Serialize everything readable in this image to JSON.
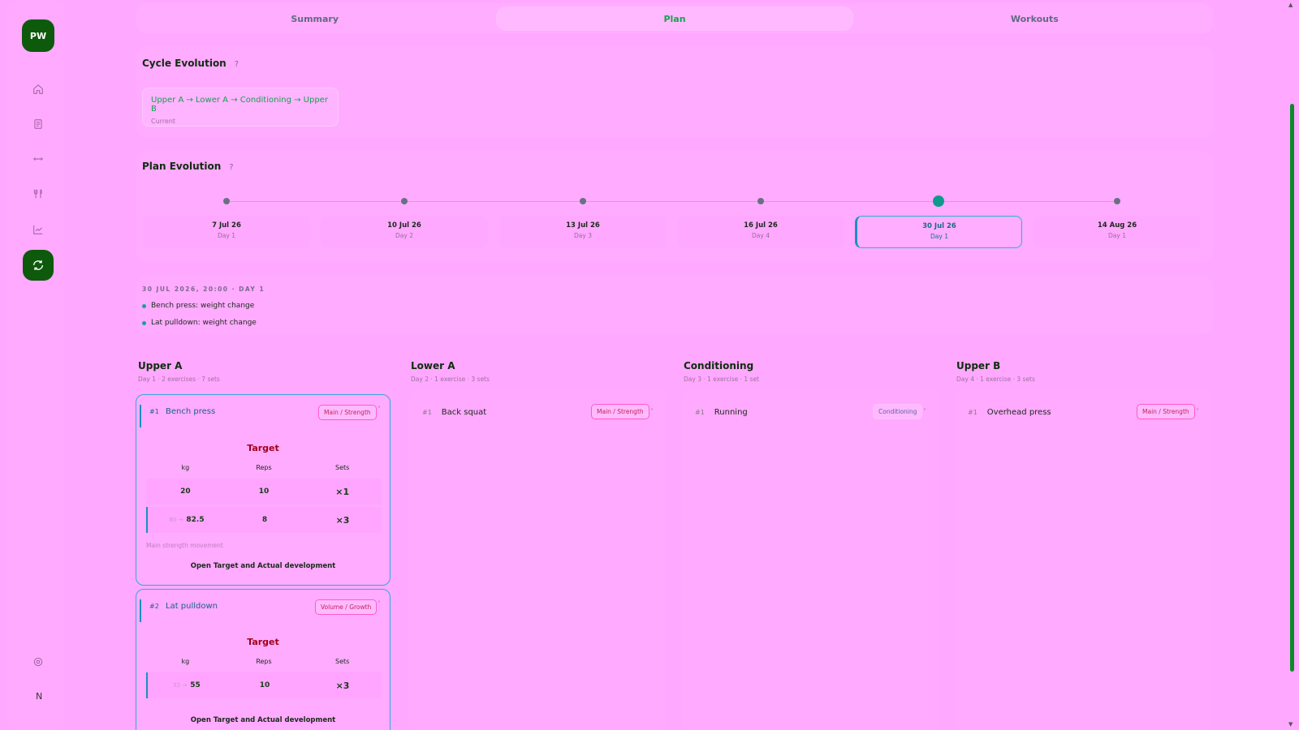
{
  "sidebar": {
    "logo": "PW",
    "user_initial": "N",
    "icons": [
      "home-icon",
      "document-icon",
      "dumbbell-icon",
      "utensils-icon",
      "chart-icon",
      "cycle-icon",
      "settings-icon"
    ]
  },
  "tabs": [
    {
      "label": "Summary"
    },
    {
      "label": "Plan",
      "active": true
    },
    {
      "label": "Workouts"
    }
  ],
  "cycle": {
    "title": "Cycle Evolution",
    "help": "?",
    "sequence": "Upper A → Lower A → Conditioning → Upper B",
    "status": "Current"
  },
  "plan": {
    "title": "Plan Evolution",
    "help": "?",
    "timeline": [
      {
        "date": "7 Jul 26",
        "day": "Day 1"
      },
      {
        "date": "10 Jul 26",
        "day": "Day 2"
      },
      {
        "date": "13 Jul 26",
        "day": "Day 3"
      },
      {
        "date": "16 Jul 26",
        "day": "Day 4"
      },
      {
        "date": "30 Jul 26",
        "day": "Day 1",
        "selected": true
      },
      {
        "date": "14 Aug 26",
        "day": "Day 1"
      }
    ],
    "changes_header": "30 JUL 2026, 20:00 · DAY 1",
    "changes": [
      "Bench press: weight change",
      "Lat pulldown: weight change"
    ]
  },
  "days": [
    {
      "title": "Upper A",
      "subtitle": "Day 1 · 2 exercises · 7 sets",
      "exercises": [
        {
          "num": "#1",
          "name": "Bench press",
          "badge": "Main / Strength",
          "target_label": "Target",
          "columns": [
            "kg",
            "Reps",
            "Sets"
          ],
          "rows": [
            {
              "prev": "",
              "kg": "20",
              "reps": "10",
              "sets": "×1"
            },
            {
              "prev": "80 →",
              "kg": "82.5",
              "reps": "8",
              "sets": "×3"
            }
          ],
          "note": "Main strength movement",
          "link": "Open Target and Actual development"
        },
        {
          "num": "#2",
          "name": "Lat pulldown",
          "badge": "Volume / Growth",
          "target_label": "Target",
          "columns": [
            "kg",
            "Reps",
            "Sets"
          ],
          "rows": [
            {
              "prev": "52 →",
              "kg": "55",
              "reps": "10",
              "sets": "×3"
            }
          ],
          "link": "Open Target and Actual development"
        }
      ]
    },
    {
      "title": "Lower A",
      "subtitle": "Day 2 · 1 exercise · 3 sets",
      "exercises": [
        {
          "num": "#1",
          "name": "Back squat",
          "badge": "Main / Strength"
        }
      ]
    },
    {
      "title": "Conditioning",
      "subtitle": "Day 3 · 1 exercise · 1 set",
      "exercises": [
        {
          "num": "#1",
          "name": "Running",
          "badge": "Conditioning"
        }
      ]
    },
    {
      "title": "Upper B",
      "subtitle": "Day 4 · 1 exercise · 3 sets",
      "exercises": [
        {
          "num": "#1",
          "name": "Overhead press",
          "badge": "Main / Strength"
        }
      ]
    }
  ]
}
